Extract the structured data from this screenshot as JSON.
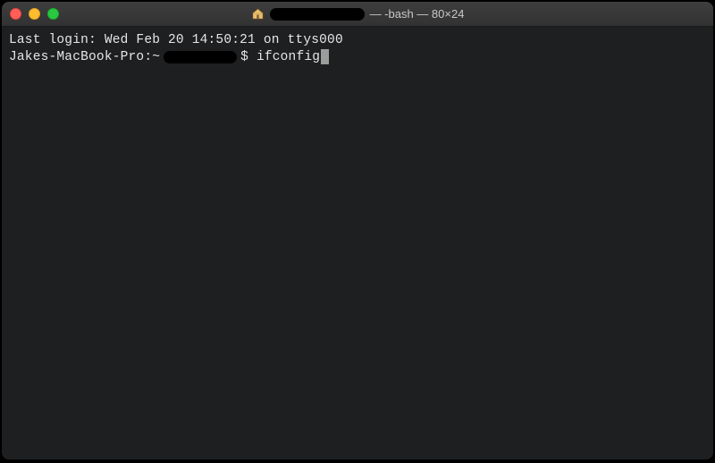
{
  "titlebar": {
    "title_suffix": "— -bash — 80×24"
  },
  "terminal": {
    "last_login_line": "Last login: Wed Feb 20 14:50:21 on ttys000",
    "prompt_host": "Jakes-MacBook-Pro:~",
    "prompt_symbol": "$ ",
    "typed_command": "ifconfig"
  }
}
